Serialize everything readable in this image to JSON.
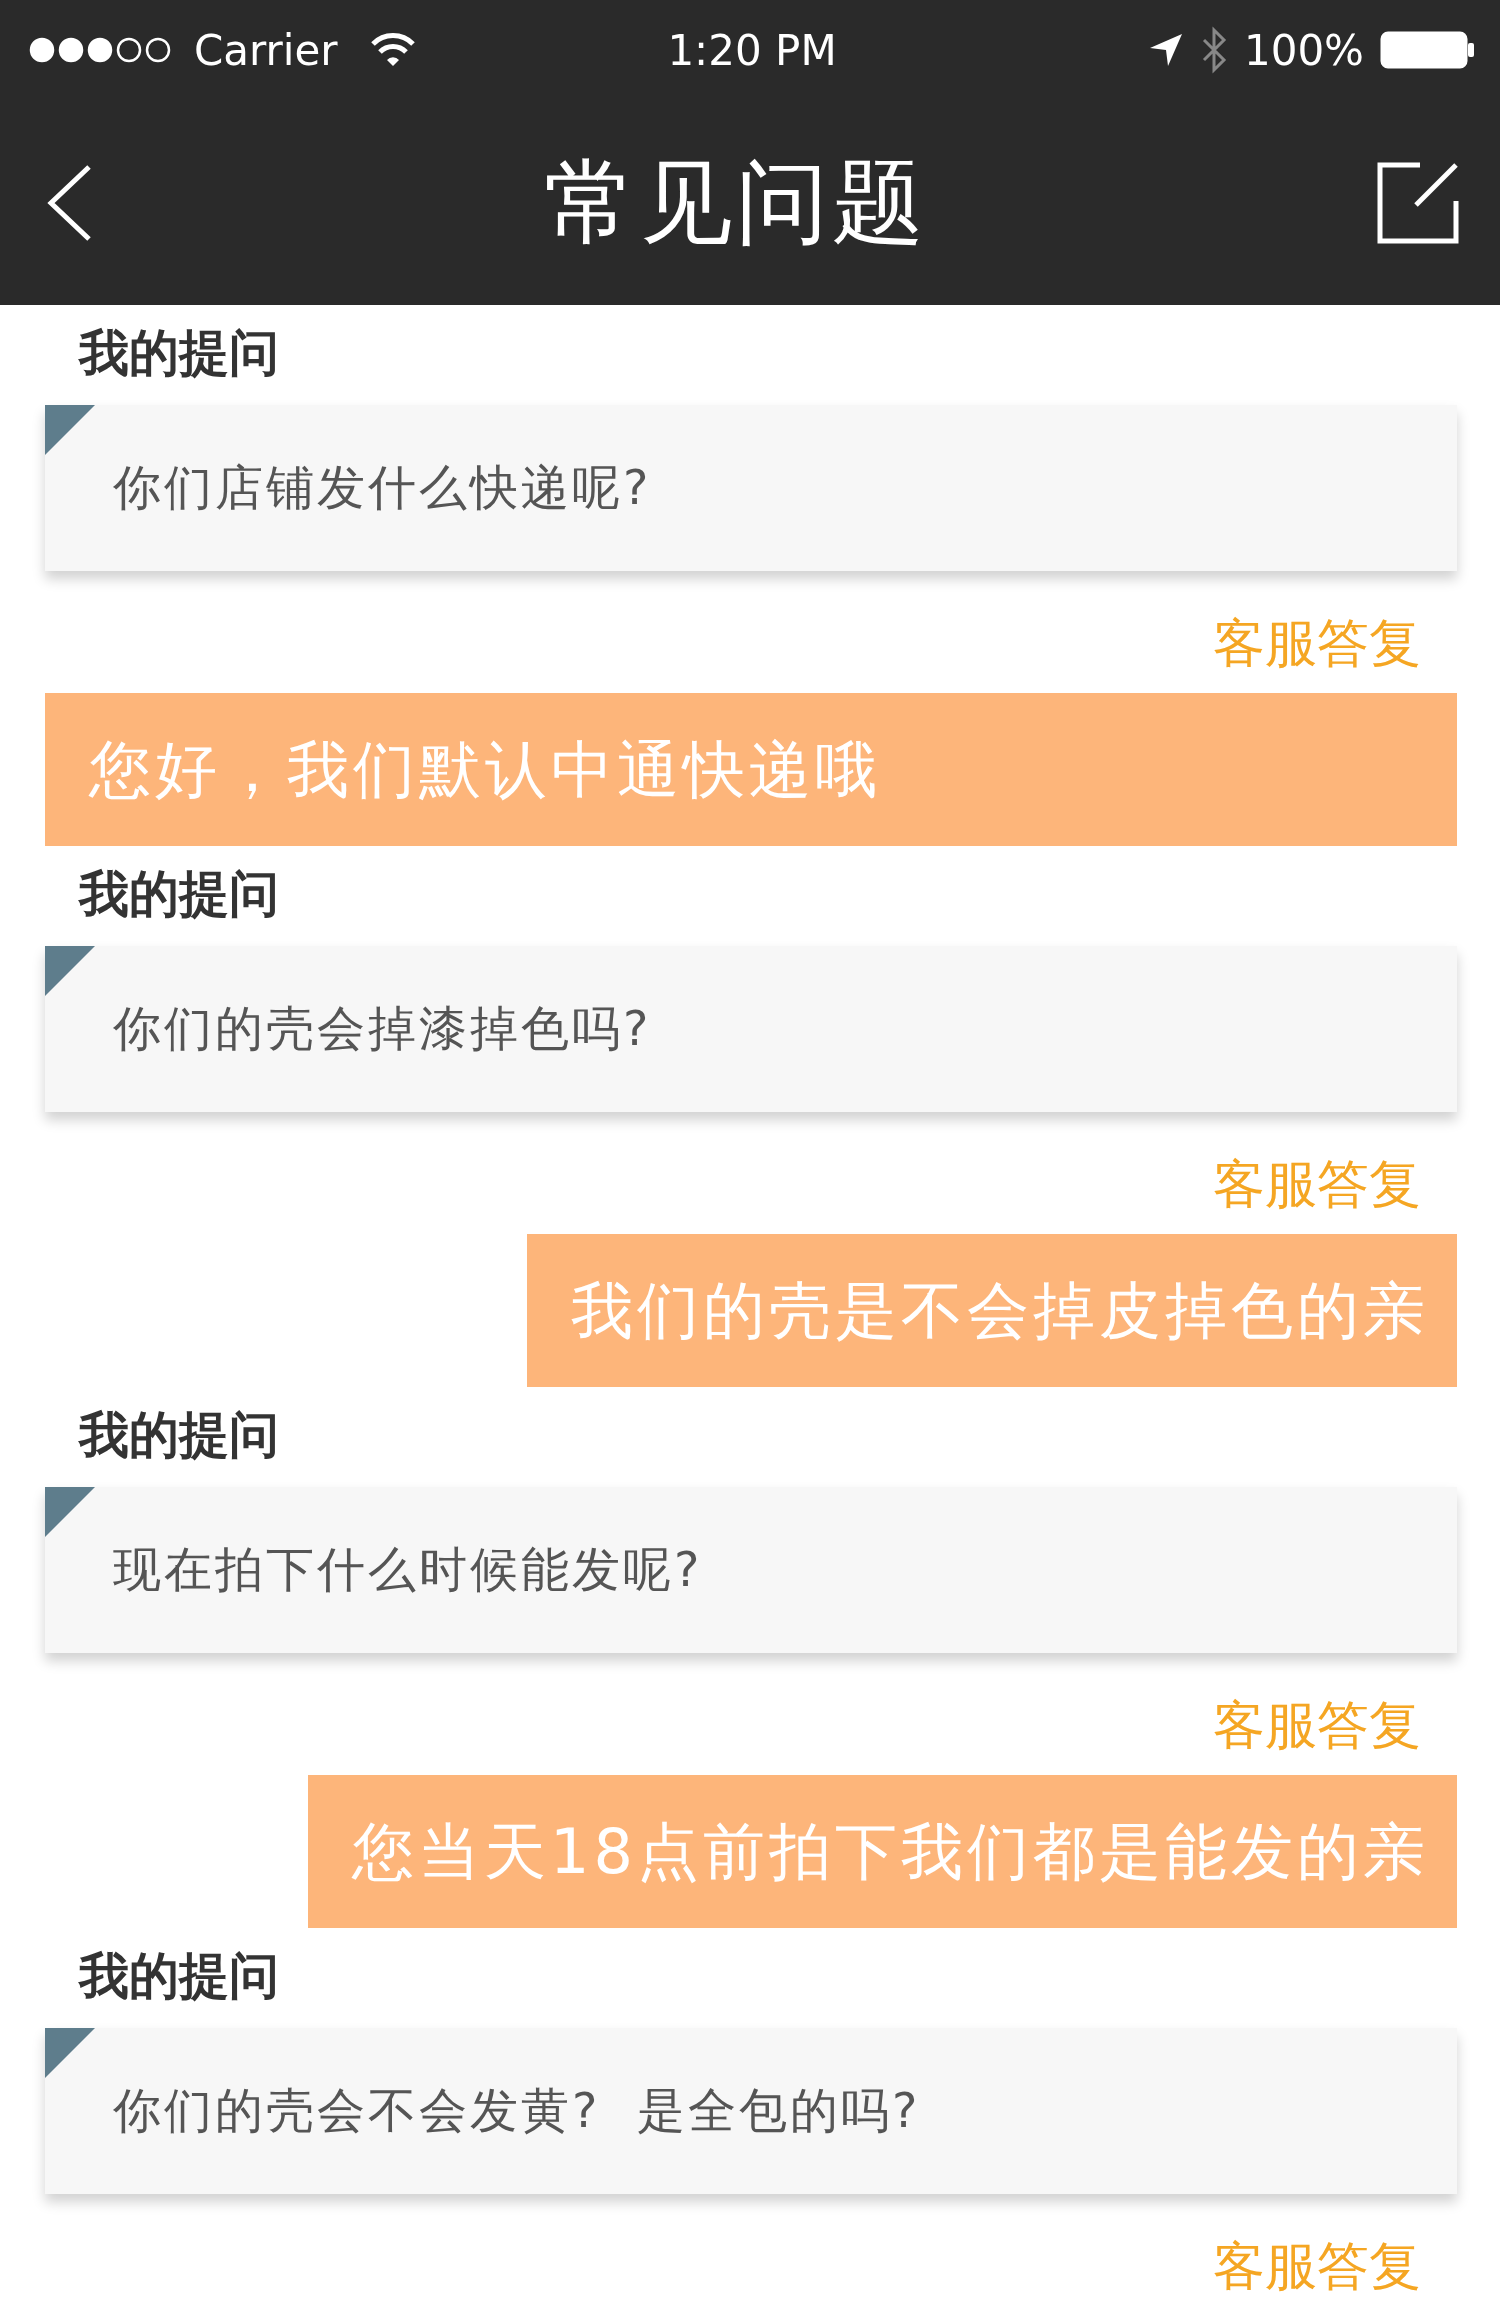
{
  "status_bar": {
    "carrier": "Carrier",
    "time": "1:20 PM",
    "battery": "100%"
  },
  "nav": {
    "title": "常见问题"
  },
  "threads": [
    {
      "label": "我的提问",
      "question": "你们店铺发什么快递呢?",
      "reply_label": "客服答复",
      "answer": {
        "text": "您好，我们默认中通快递哦",
        "kind": "full"
      }
    },
    {
      "label": "我的提问",
      "question": "你们的壳会掉漆掉色吗?",
      "reply_label": "客服答复",
      "answer": {
        "text": "我们的壳是不会掉皮掉色的亲",
        "kind": "fit"
      }
    },
    {
      "label": "我的提问",
      "question": "现在拍下什么时候能发呢?",
      "reply_label": "客服答复",
      "answer": {
        "text": "您当天18点前拍下我们都是能发的亲",
        "kind": "fit"
      }
    },
    {
      "label": "我的提问",
      "question": "你们的壳会不会发黄?  是全包的吗?",
      "reply_label": "客服答复"
    }
  ]
}
